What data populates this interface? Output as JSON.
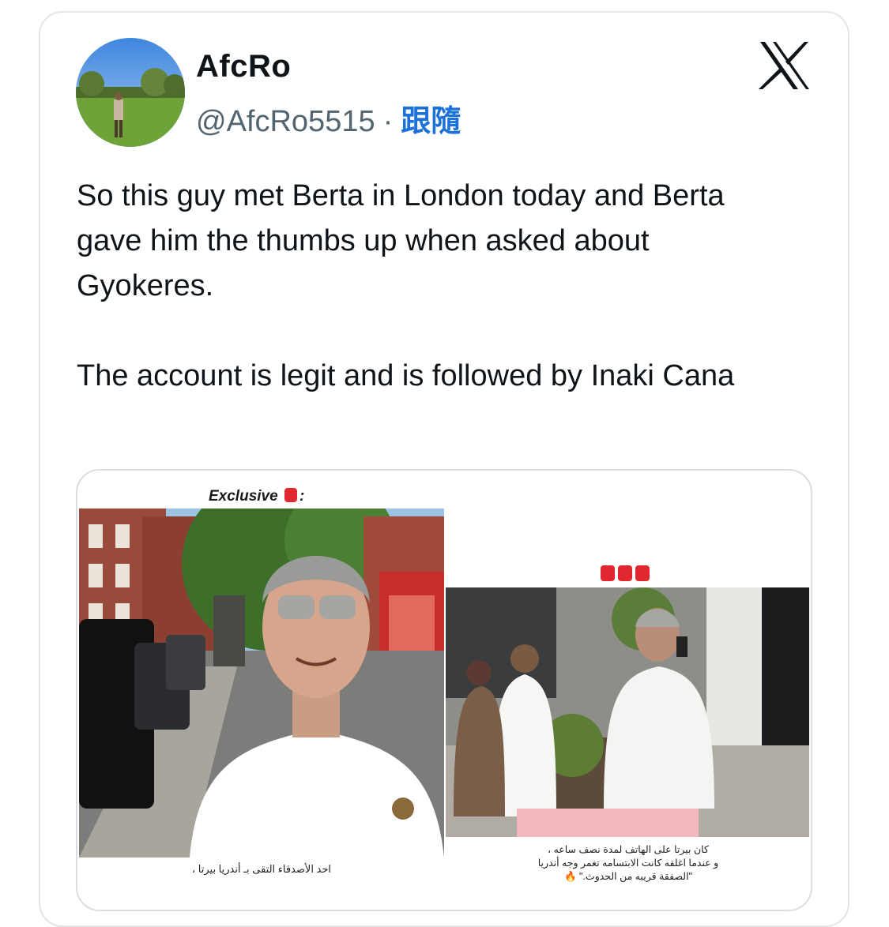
{
  "author": {
    "display_name": "AfcRo",
    "handle": "@AfcRo5515",
    "separator": "·",
    "follow_label": "跟隨"
  },
  "tweet": {
    "text": "So this guy met Berta in London today and Berta gave him the thumbs up when asked about Gyokeres.\n\nThe account is legit and is followed by Inaki Cana"
  },
  "media": {
    "left_header": "Exclusive",
    "left_caption_line1": "احد الأصدقاء التقى بـ أندريا بيرتا ،",
    "right_caption_line1": "كان بيرتا على الهاتف لمدة نصف ساعه ،",
    "right_caption_line2": "و عندما اغلقه كانت الابتسامه تغمر وجه أندريا",
    "right_caption_line3": "\"الصفقة قريبه من الحدوث.\" 🔥"
  },
  "colors": {
    "follow": "#1d72d8",
    "text": "#0f1419",
    "muted": "#536471"
  },
  "icons": {
    "logo": "x-logo-icon",
    "siren": "siren-icon"
  }
}
